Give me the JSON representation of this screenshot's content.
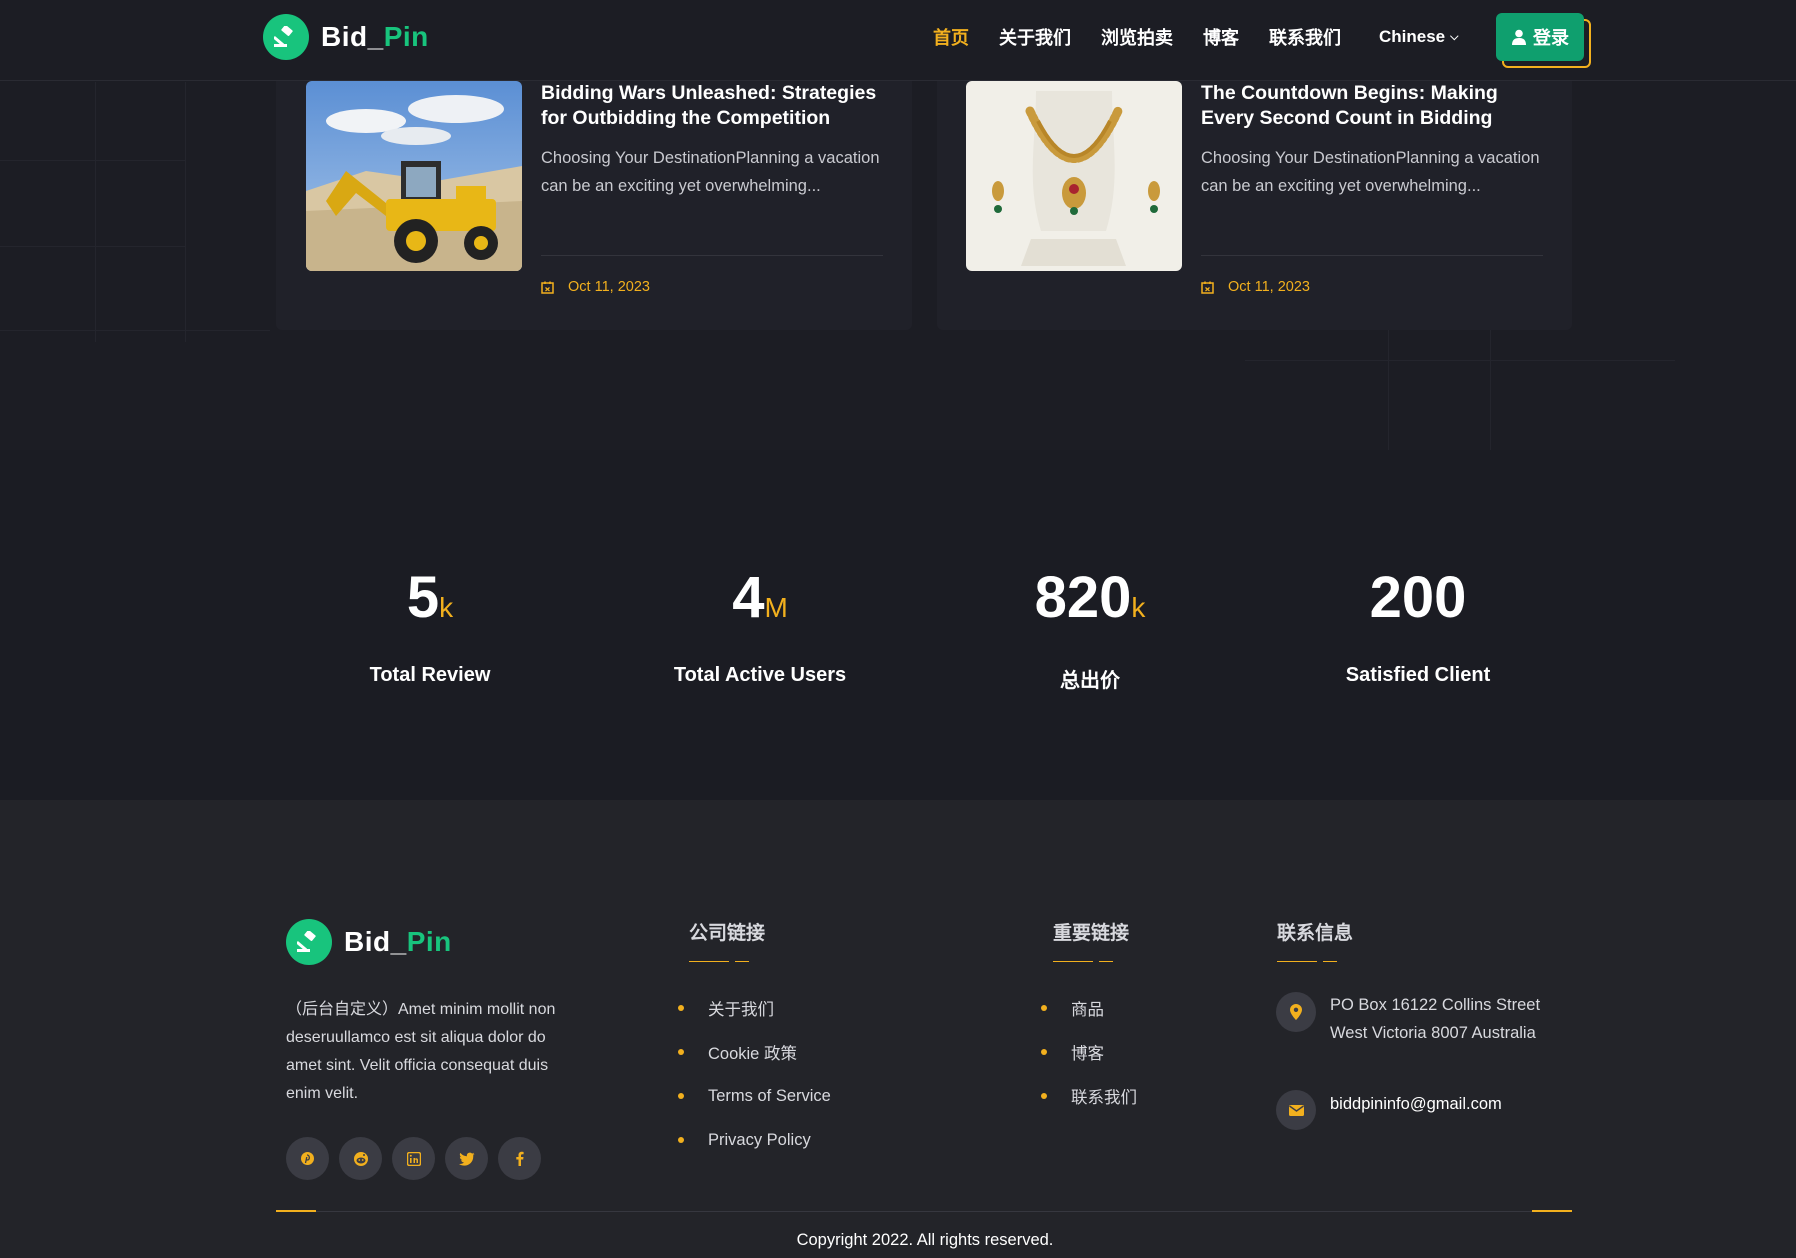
{
  "header": {
    "logo": {
      "part1": "Bid_",
      "part2": "Pin"
    },
    "nav": [
      {
        "label": "首页",
        "active": true
      },
      {
        "label": "关于我们",
        "active": false
      },
      {
        "label": "浏览拍卖",
        "active": false
      },
      {
        "label": "博客",
        "active": false
      },
      {
        "label": "联系我们",
        "active": false
      }
    ],
    "language": "Chinese",
    "login_label": "登录"
  },
  "blog": [
    {
      "title": "Bidding Wars Unleashed: Strategies for Outbidding the Competition",
      "excerpt": "Choosing Your DestinationPlanning a vacation can be an exciting yet overwhelming...",
      "date": "Oct 11, 2023",
      "image": "backhoe-loader"
    },
    {
      "title": "The Countdown Begins: Making Every Second Count in Bidding",
      "excerpt": "Choosing Your DestinationPlanning a vacation can be an exciting yet overwhelming...",
      "date": "Oct 11, 2023",
      "image": "gold-necklace"
    }
  ],
  "stats": [
    {
      "value": "5",
      "unit": "k",
      "label": "Total Review"
    },
    {
      "value": "4",
      "unit": "M",
      "label": "Total Active Users"
    },
    {
      "value": "820",
      "unit": "k",
      "label": "总出价"
    },
    {
      "value": "200",
      "unit": "",
      "label": "Satisfied Client"
    }
  ],
  "footer": {
    "logo": {
      "part1": "Bid_",
      "part2": "Pin"
    },
    "description": "（后台自定义）Amet minim mollit non deseruullamco est sit aliqua dolor do amet sint. Velit officia consequat duis enim velit.",
    "social": [
      "pinterest-icon",
      "reddit-icon",
      "linkedin-icon",
      "twitter-icon",
      "facebook-icon"
    ],
    "company_links": {
      "heading": "公司链接",
      "items": [
        "关于我们",
        "Cookie 政策",
        "Terms of Service",
        "Privacy Policy"
      ]
    },
    "important_links": {
      "heading": "重要链接",
      "items": [
        "商品",
        "博客",
        "联系我们"
      ]
    },
    "contact": {
      "heading": "联系信息",
      "address": "PO Box 16122 Collins Street West Victoria 8007 Australia",
      "email": "biddpininfo@gmail.com"
    },
    "copyright": "Copyright 2022. All rights reserved."
  },
  "colors": {
    "accent": "#f2b01e",
    "brand": "#18c47d",
    "background": "#1c1d24"
  }
}
